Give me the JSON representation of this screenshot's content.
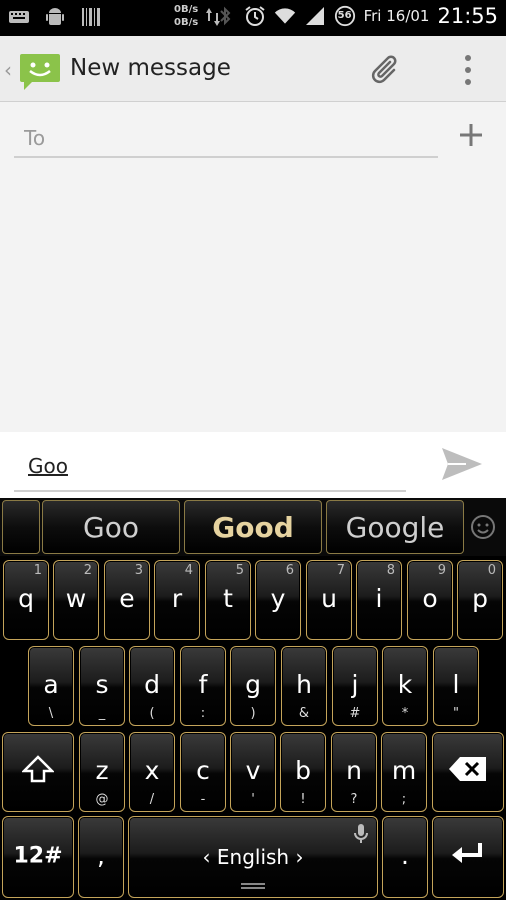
{
  "status_bar": {
    "rate_up": "0B/s",
    "rate_down": "0B/s",
    "battery": "56",
    "date": "Fri 16/01",
    "time": "21:55"
  },
  "action_bar": {
    "title": "New message",
    "icons": [
      "back-chevron",
      "messaging-logo",
      "attach-icon",
      "overflow-menu-icon"
    ]
  },
  "compose": {
    "to_placeholder": "To",
    "message_text": "Goo"
  },
  "keyboard": {
    "suggestions": [
      "Goo",
      "Good",
      "Google"
    ],
    "row1": [
      {
        "k": "q",
        "n": "1"
      },
      {
        "k": "w",
        "n": "2"
      },
      {
        "k": "e",
        "n": "3"
      },
      {
        "k": "r",
        "n": "4"
      },
      {
        "k": "t",
        "n": "5"
      },
      {
        "k": "y",
        "n": "6"
      },
      {
        "k": "u",
        "n": "7"
      },
      {
        "k": "i",
        "n": "8"
      },
      {
        "k": "o",
        "n": "9"
      },
      {
        "k": "p",
        "n": "0"
      }
    ],
    "row2": [
      {
        "k": "a",
        "s": "\\"
      },
      {
        "k": "s",
        "s": "_"
      },
      {
        "k": "d",
        "s": "("
      },
      {
        "k": "f",
        "s": ":"
      },
      {
        "k": "g",
        "s": ")"
      },
      {
        "k": "h",
        "s": "&"
      },
      {
        "k": "j",
        "s": "#"
      },
      {
        "k": "k",
        "s": "*"
      },
      {
        "k": "l",
        "s": "\""
      }
    ],
    "row3": [
      {
        "k": "z",
        "s": "@"
      },
      {
        "k": "x",
        "s": "/"
      },
      {
        "k": "c",
        "s": "-"
      },
      {
        "k": "v",
        "s": "'"
      },
      {
        "k": "b",
        "s": "!"
      },
      {
        "k": "n",
        "s": "?"
      },
      {
        "k": "m",
        "s": ";"
      }
    ],
    "row4": {
      "symbols": "12#",
      "comma": ",",
      "space_label": "‹ English ›",
      "period": "."
    }
  }
}
